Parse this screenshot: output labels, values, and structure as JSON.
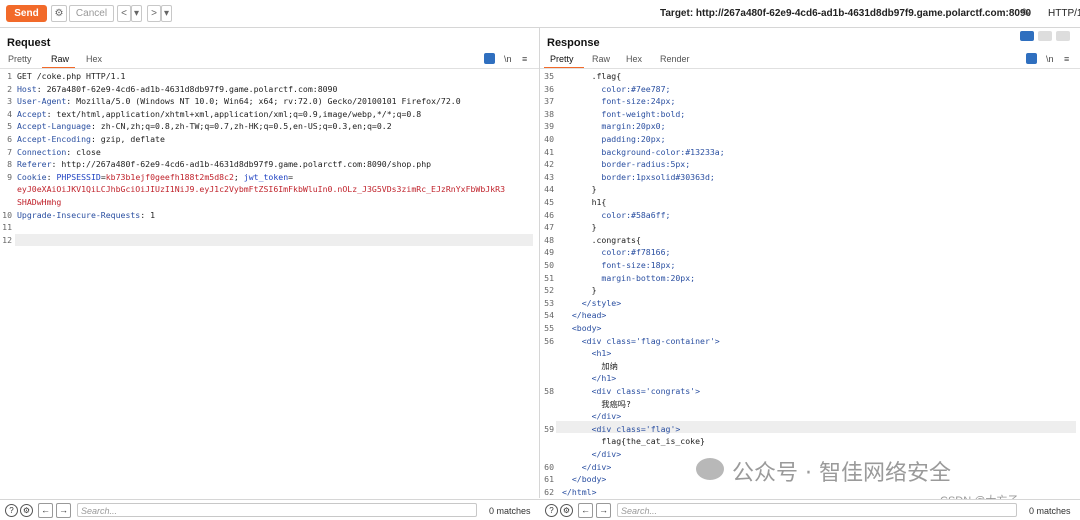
{
  "toolbar": {
    "send_label": "Send",
    "cancel_label": "Cancel",
    "back_glyph": "<",
    "forward_glyph": ">",
    "dropdown_glyph": "▾",
    "target_text": "Target: http://267a480f-62e9-4cd6-ad1b-4631d8db97f9.game.polarctf.com:8090",
    "protocol": "HTTP/1"
  },
  "request": {
    "title": "Request",
    "tabs": [
      "Pretty",
      "Raw",
      "Hex"
    ],
    "active_tab": "Raw",
    "lines": [
      {
        "n": "1",
        "k": "",
        "v": "GET /coke.php HTTP/1.1"
      },
      {
        "n": "2",
        "k": "Host",
        "v": ": 267a480f-62e9-4cd6-ad1b-4631d8db97f9.game.polarctf.com:8090"
      },
      {
        "n": "3",
        "k": "User-Agent",
        "v": ": Mozilla/5.0 (Windows NT 10.0; Win64; x64; rv:72.0) Gecko/20100101 Firefox/72.0"
      },
      {
        "n": "4",
        "k": "Accept",
        "v": ": text/html,application/xhtml+xml,application/xml;q=0.9,image/webp,*/*;q=0.8"
      },
      {
        "n": "5",
        "k": "Accept-Language",
        "v": ": zh-CN,zh;q=0.8,zh-TW;q=0.7,zh-HK;q=0.5,en-US;q=0.3,en;q=0.2"
      },
      {
        "n": "6",
        "k": "Accept-Encoding",
        "v": ": gzip, deflate"
      },
      {
        "n": "7",
        "k": "Connection",
        "v": ": close"
      },
      {
        "n": "8",
        "k": "Referer",
        "v": ": http://267a480f-62e9-4cd6-ad1b-4631d8db97f9.game.polarctf.com:8090/shop.php"
      },
      {
        "n": "9",
        "k": "Cookie",
        "v": ": "
      }
    ],
    "cookie_phpsessid_name": "PHPSESSID",
    "cookie_phpsessid_value": "kb73b1ejf0geefh188t2m5d8c2",
    "cookie_jwt_name": "jwt_token",
    "cookie_jwt_line1": "eyJ0eXAiOiJKV1QiLCJhbGciOiJIUzI1NiJ9.eyJ1c2VybmFtZSI6ImFkbWluIn0.nOLz_J3G5VDs3zimRc_EJzRnYxFbWbJkR3",
    "cookie_jwt_line2": "SHADwHmhg",
    "line10_n": "10",
    "line10_k": "Upgrade-Insecure-Requests",
    "line10_v": ": 1",
    "line11_n": "11",
    "line12_n": "12"
  },
  "response": {
    "title": "Response",
    "tabs": [
      "Pretty",
      "Raw",
      "Hex",
      "Render"
    ],
    "active_tab": "Pretty",
    "lines": [
      {
        "n": "35",
        "t": "      .flag{"
      },
      {
        "n": "36",
        "t": "        color:#7ee787;"
      },
      {
        "n": "37",
        "t": "        font-size:24px;"
      },
      {
        "n": "38",
        "t": "        font-weight:bold;"
      },
      {
        "n": "39",
        "t": "        margin:20px0;"
      },
      {
        "n": "40",
        "t": "        padding:20px;"
      },
      {
        "n": "41",
        "t": "        background-color:#13233a;"
      },
      {
        "n": "42",
        "t": "        border-radius:5px;"
      },
      {
        "n": "43",
        "t": "        border:1pxsolid#30363d;"
      },
      {
        "n": "44",
        "t": "      }"
      },
      {
        "n": "45",
        "t": "      h1{"
      },
      {
        "n": "46",
        "t": "        color:#58a6ff;"
      },
      {
        "n": "47",
        "t": "      }"
      },
      {
        "n": "48",
        "t": "      .congrats{"
      },
      {
        "n": "49",
        "t": "        color:#f78166;"
      },
      {
        "n": "50",
        "t": "        font-size:18px;"
      },
      {
        "n": "51",
        "t": "        margin-bottom:20px;"
      },
      {
        "n": "52",
        "t": "      }"
      },
      {
        "n": "53",
        "t": "    </style>"
      },
      {
        "n": "54",
        "t": "  </head>"
      },
      {
        "n": "55",
        "t": "  <body>"
      },
      {
        "n": "56",
        "t": "    <div class='flag-container'>"
      },
      {
        "n": "",
        "t": "      <h1>"
      },
      {
        "n": "",
        "t": "        加纳"
      },
      {
        "n": "",
        "t": "      </h1>"
      },
      {
        "n": "58",
        "t": "      <div class='congrats'>"
      },
      {
        "n": "",
        "t": "        我癌吗?"
      },
      {
        "n": "",
        "t": "      </div>"
      },
      {
        "n": "59",
        "t": "      <div class='flag'>"
      },
      {
        "n": "",
        "t": "        flag{the_cat_is_coke}"
      },
      {
        "n": "",
        "t": "      </div>"
      },
      {
        "n": "60",
        "t": "    </div>"
      },
      {
        "n": "61",
        "t": "  </body>"
      },
      {
        "n": "62",
        "t": "</html>"
      }
    ]
  },
  "bottom": {
    "search_placeholder": "Search...",
    "matches_left": "0 matches",
    "matches_right": "0 matches"
  },
  "watermark": {
    "main": "公众号 · 智佳网络安全",
    "sub": "CSDN @大方子"
  },
  "colors": {
    "accent": "#f26a2a",
    "key": "#2a4fa1",
    "cookie_value": "#c0232c"
  }
}
